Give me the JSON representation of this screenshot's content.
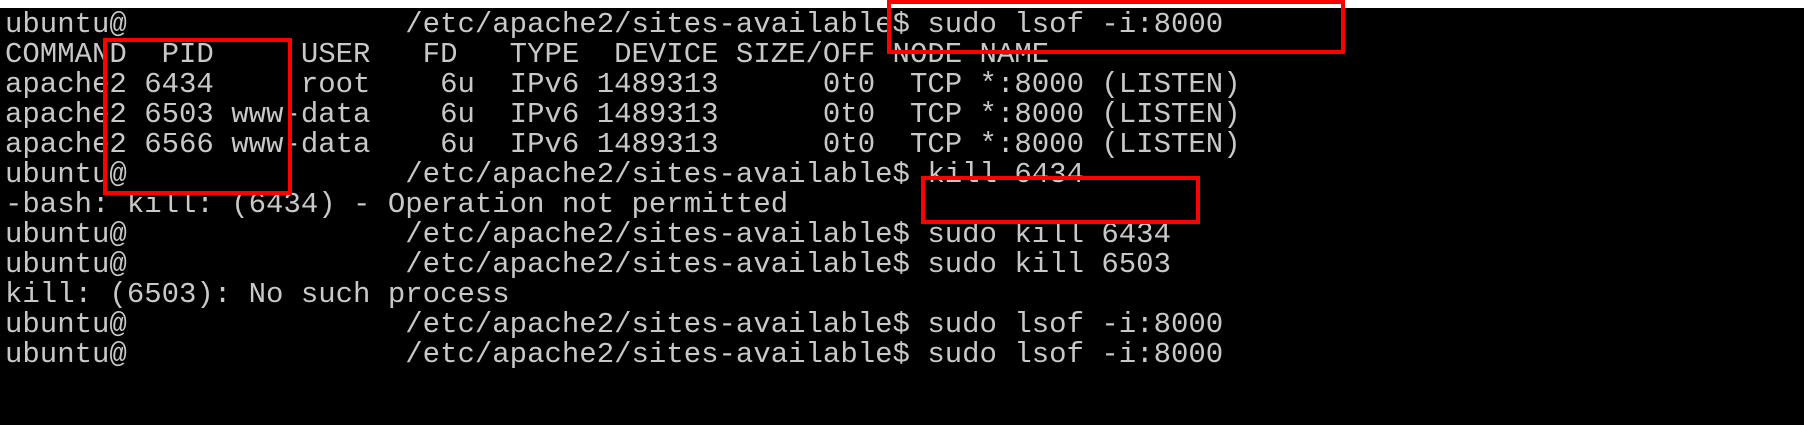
{
  "terminal": {
    "lines": [
      "ubuntu@               :/etc/apache2/sites-available$ sudo lsof -i:8000",
      "COMMAND  PID     USER   FD   TYPE  DEVICE SIZE/OFF NODE NAME",
      "apache2 6434     root    6u  IPv6 1489313      0t0  TCP *:8000 (LISTEN)",
      "apache2 6503 www-data    6u  IPv6 1489313      0t0  TCP *:8000 (LISTEN)",
      "apache2 6566 www-data    6u  IPv6 1489313      0t0  TCP *:8000 (LISTEN)",
      "ubuntu@               :/etc/apache2/sites-available$ kill 6434",
      "-bash: kill: (6434) - Operation not permitted",
      "ubuntu@               :/etc/apache2/sites-available$ sudo kill 6434",
      "ubuntu@               :/etc/apache2/sites-available$ sudo kill 6503",
      "kill: (6503): No such process",
      "ubuntu@               :/etc/apache2/sites-available$ sudo lsof -i:8000",
      "ubuntu@               :/etc/apache2/sites-available$ sudo lsof -i:8000"
    ]
  },
  "colors": {
    "background": "#000000",
    "text": "#c8c8c8",
    "annotation": "#ff0000",
    "page": "#ffffff"
  }
}
